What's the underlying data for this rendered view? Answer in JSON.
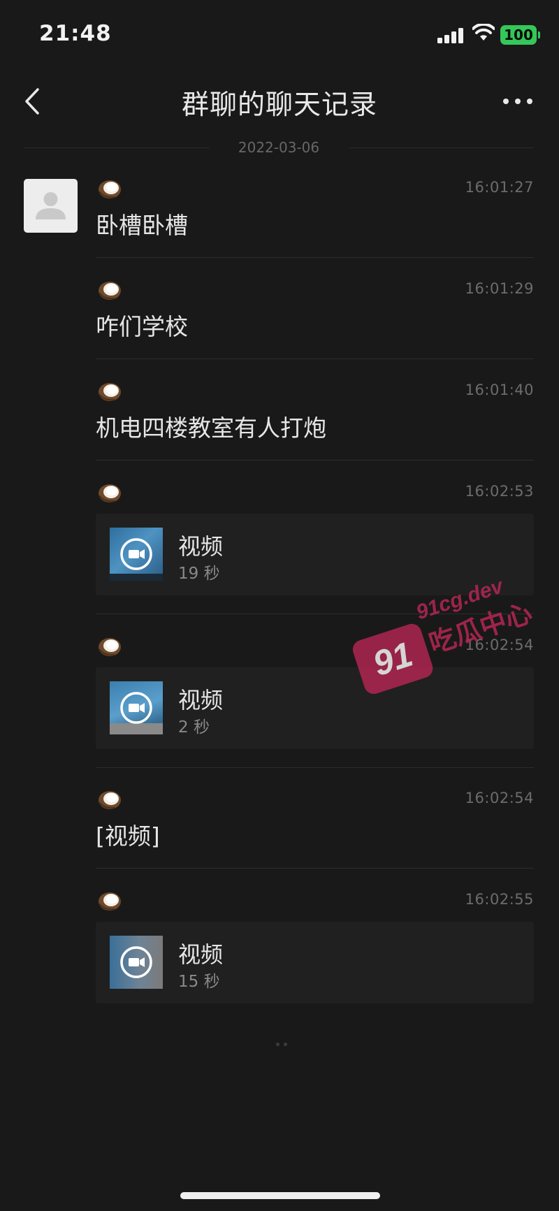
{
  "status_bar": {
    "time": "21:48",
    "battery": "100"
  },
  "nav": {
    "title": "群聊的聊天记录"
  },
  "date_divider": "2022-03-06",
  "messages": [
    {
      "time": "16:01:27",
      "text": "卧槽卧槽"
    },
    {
      "time": "16:01:29",
      "text": "咋们学校"
    },
    {
      "time": "16:01:40",
      "text": "机电四楼教室有人打炮"
    },
    {
      "time": "16:02:53",
      "video_title": "视频",
      "video_duration": "19 秒"
    },
    {
      "time": "16:02:54",
      "video_title": "视频",
      "video_duration": "2 秒"
    },
    {
      "time": "16:02:54",
      "text": "[视频]"
    },
    {
      "time": "16:02:55",
      "video_title": "视频",
      "video_duration": "15 秒"
    }
  ],
  "watermark": {
    "badge": "91",
    "domain": "91cg.dev",
    "name": "吃瓜中心"
  },
  "colors": {
    "background": "#191919",
    "card": "#202020",
    "battery": "#34c759",
    "watermark": "#b52654"
  }
}
